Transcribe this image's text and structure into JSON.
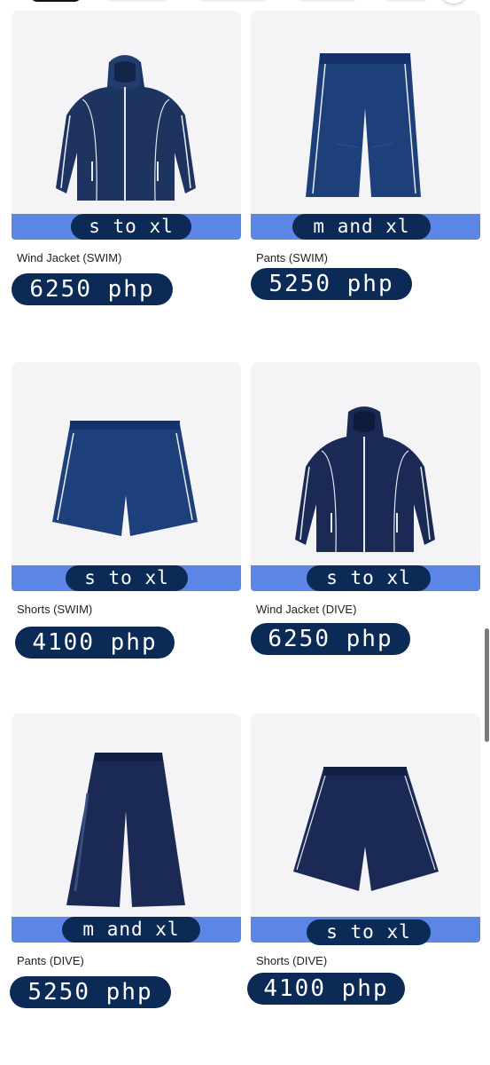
{
  "products": [
    {
      "name": "Wind Jacket (SWIM)",
      "sizes": "s to xl",
      "price": "6250 php",
      "icon": "wind-jacket-icon"
    },
    {
      "name": "Pants (SWIM)",
      "sizes": "m and xl",
      "price": "5250 php",
      "icon": "pants-icon"
    },
    {
      "name": "Shorts (SWIM)",
      "sizes": "s to xl",
      "price": "4100 php",
      "icon": "shorts-icon"
    },
    {
      "name": "Wind Jacket (DIVE)",
      "sizes": "s to xl",
      "price": "6250 php",
      "icon": "wind-jacket-icon"
    },
    {
      "name": "Pants (DIVE)",
      "sizes": "m and xl",
      "price": "5250 php",
      "icon": "pants-icon"
    },
    {
      "name": "Shorts (DIVE)",
      "sizes": "s to xl",
      "price": "4100 php",
      "icon": "shorts-icon"
    }
  ],
  "colors": {
    "label_bg": "#0b2a56",
    "size_bar": "#5b86e5",
    "card_bg": "#f4f4f6",
    "garment_navy": "#1d3461"
  }
}
